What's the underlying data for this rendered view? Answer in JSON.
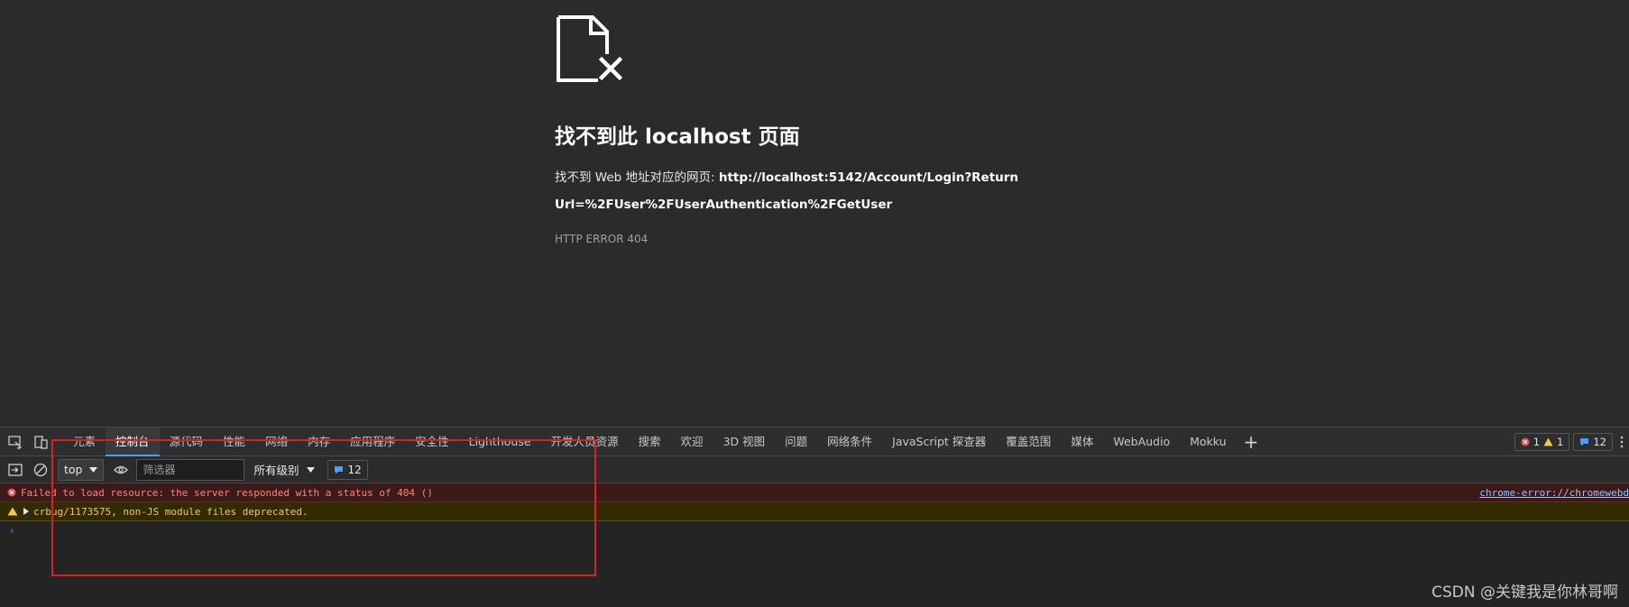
{
  "error_page": {
    "title": "找不到此 localhost 页面",
    "description_prefix": "找不到 Web 地址对应的网页: ",
    "url": "http://localhost:5142/Account/Login?ReturnUrl=%2FUser%2FUserAuthentication%2FGetUser",
    "error_code": "HTTP ERROR 404",
    "icon": "broken-document-icon"
  },
  "devtools": {
    "tabs": [
      {
        "label": "元素",
        "active": false
      },
      {
        "label": "控制台",
        "active": true
      },
      {
        "label": "源代码",
        "active": false
      },
      {
        "label": "性能",
        "active": false
      },
      {
        "label": "网络",
        "active": false
      },
      {
        "label": "内存",
        "active": false
      },
      {
        "label": "应用程序",
        "active": false
      },
      {
        "label": "安全性",
        "active": false
      },
      {
        "label": "Lighthouse",
        "active": false
      },
      {
        "label": "开发人员资源",
        "active": false
      },
      {
        "label": "搜索",
        "active": false
      },
      {
        "label": "欢迎",
        "active": false
      },
      {
        "label": "3D 视图",
        "active": false
      },
      {
        "label": "问题",
        "active": false
      },
      {
        "label": "网络条件",
        "active": false
      },
      {
        "label": "JavaScript 探查器",
        "active": false
      },
      {
        "label": "覆盖范围",
        "active": false
      },
      {
        "label": "媒体",
        "active": false
      },
      {
        "label": "WebAudio",
        "active": false
      },
      {
        "label": "Mokku",
        "active": false
      }
    ],
    "add_tab": "+",
    "counts": {
      "errors": "1",
      "warnings": "1",
      "messages": "12"
    },
    "toolbar": {
      "context": "top",
      "filter_placeholder": "筛选器",
      "levels": "所有级别",
      "message_count": "12"
    },
    "console": {
      "error_message": "Failed to load resource: the server responded with a status of 404 ()",
      "error_source": "chrome-error://chromewebd",
      "warning_message": "crbug/1173575, non-JS module files deprecated.",
      "prompt": "›"
    }
  },
  "colors": {
    "page_bg": "#2b2b2b",
    "accent": "#4a9eff",
    "error": "#ff8080",
    "warning": "#f2c94c",
    "highlight": "#e02020"
  },
  "watermark": "CSDN @关键我是你林哥啊"
}
